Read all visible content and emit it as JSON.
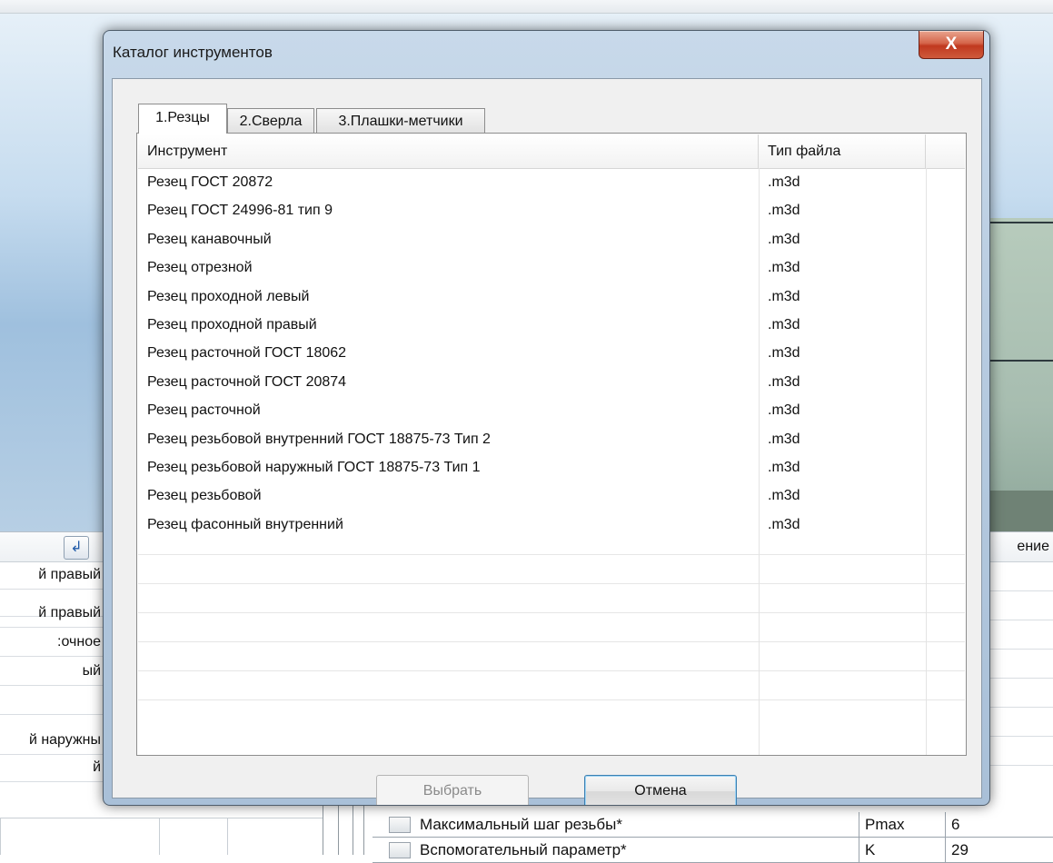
{
  "dialog": {
    "title": "Каталог инструментов",
    "close_glyph": "X",
    "tabs": [
      {
        "label": "1.Резцы",
        "active": true
      },
      {
        "label": "2.Сверла",
        "active": false
      },
      {
        "label": "3.Плашки-метчики",
        "active": false
      }
    ],
    "list": {
      "columns": [
        "Инструмент",
        "Тип файла"
      ],
      "rows": [
        [
          "Резец ГОСТ 20872",
          ".m3d"
        ],
        [
          "Резец ГОСТ 24996-81 тип 9",
          ".m3d"
        ],
        [
          "Резец канавочный",
          ".m3d"
        ],
        [
          "Резец отрезной",
          ".m3d"
        ],
        [
          "Резец проходной левый",
          ".m3d"
        ],
        [
          "Резец проходной правый",
          ".m3d"
        ],
        [
          "Резец расточной ГОСТ 18062",
          ".m3d"
        ],
        [
          "Резец расточной ГОСТ 20874",
          ".m3d"
        ],
        [
          "Резец расточной",
          ".m3d"
        ],
        [
          "Резец резьбовой внутренний ГОСТ 18875-73 Тип 2",
          ".m3d"
        ],
        [
          "Резец резьбовой наружный ГОСТ 18875-73 Тип 1",
          ".m3d"
        ],
        [
          "Резец резьбовой",
          ".m3d"
        ],
        [
          "Резец фасонный внутренний",
          ".m3d"
        ]
      ]
    },
    "buttons": {
      "select": "Выбрать",
      "cancel": "Отмена"
    }
  },
  "background": {
    "left_rows": [
      "й правый",
      ":очное",
      "ый",
      "",
      "й наружны",
      "й"
    ],
    "right_header": "ение",
    "bottom_rows": [
      {
        "name": "Максимальный шаг резьбы*",
        "symbol": "Pmax",
        "value": "6"
      },
      {
        "name": "Вспомогательный параметр*",
        "symbol": "K",
        "value": "29"
      }
    ]
  }
}
